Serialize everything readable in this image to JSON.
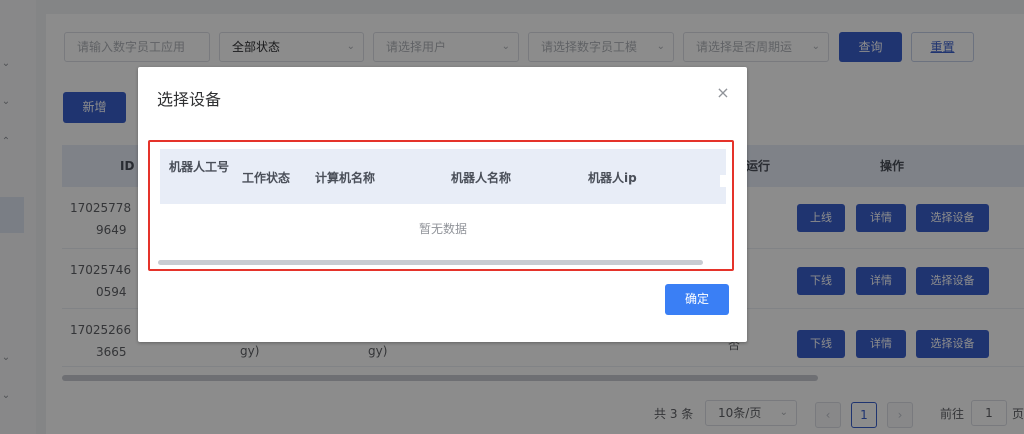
{
  "filters": {
    "app_name_placeholder": "请输入数字员工应用",
    "status_value": "全部状态",
    "user_placeholder": "请选择用户",
    "model_placeholder": "请选择数字员工模",
    "period_placeholder": "请选择是否周期运"
  },
  "toolbar": {
    "query_label": "查询",
    "reset_label": "重置",
    "add_label": "新增"
  },
  "table": {
    "headers": {
      "id": "ID",
      "run": "运行",
      "actions": "操作"
    },
    "rows": [
      {
        "id_line1": "17025778",
        "id_line2": "9649",
        "status_action": "上线",
        "detail": "详情",
        "select": "选择设备"
      },
      {
        "id_line1": "17025746",
        "id_line2": "0594",
        "status_action": "下线",
        "detail": "详情",
        "select": "选择设备"
      },
      {
        "id_line1": "17025266",
        "id_line2": "3665",
        "status_action": "下线",
        "detail": "详情",
        "select": "选择设备"
      }
    ],
    "partial_text_1": "gy)",
    "partial_text_2": "gy)",
    "partial_text_3": "否"
  },
  "pagination": {
    "total": "共 3 条",
    "page_size": "10条/页",
    "prev_icon": "‹",
    "next_icon": "›",
    "current_page": "1",
    "goto_label": "前往",
    "goto_value": "1",
    "goto_suffix": "页"
  },
  "dialog": {
    "title": "选择设备",
    "close_icon": "×",
    "columns": [
      "机器人工号",
      "工作状态",
      "计算机名称",
      "机器人名称",
      "机器人ip"
    ],
    "empty_text": "暂无数据",
    "confirm_label": "确定"
  }
}
